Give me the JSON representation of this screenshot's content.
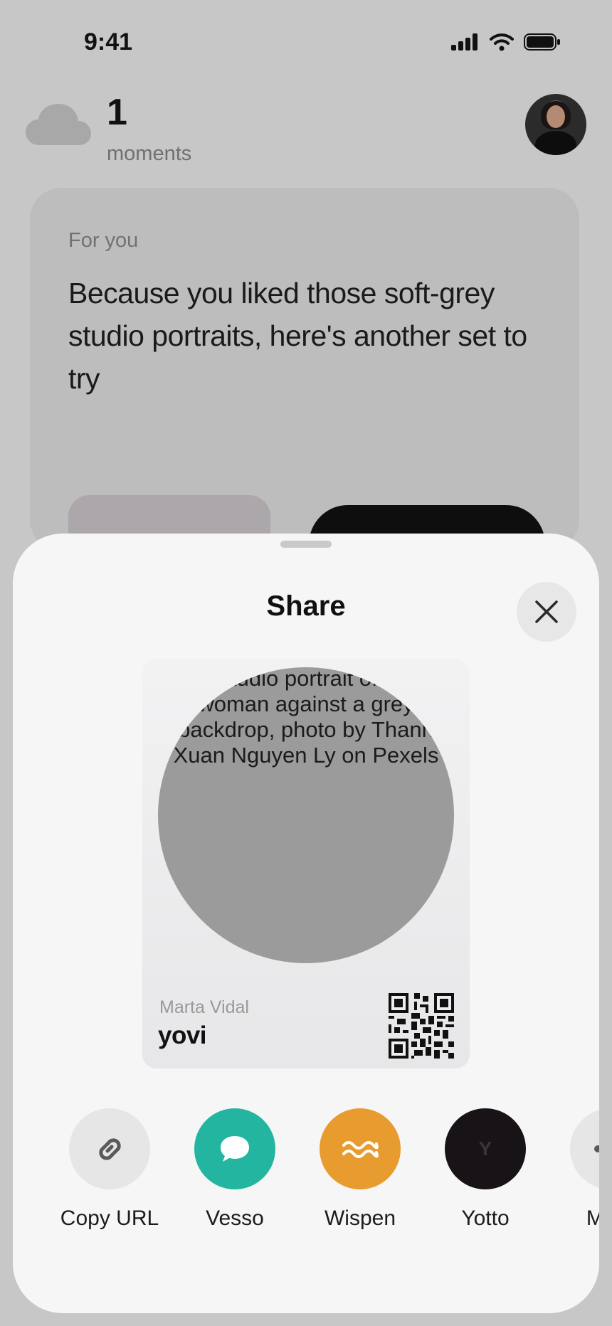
{
  "status_bar": {
    "time": "9:41"
  },
  "header": {
    "moments_count": "1",
    "moments_label": "moments"
  },
  "feed_card": {
    "kicker": "For you",
    "text": "Because you liked those soft-grey studio portraits, here's another set to try"
  },
  "share_sheet": {
    "title": "Share",
    "preview": {
      "alt_text": "Studio portrait of a\nwoman against a grey\nbackdrop, photo by Thanh\nXuan Nguyen Ly on Pexels",
      "author": "Marta Vidal",
      "brand": "yovi"
    },
    "targets": [
      {
        "label": "Copy URL",
        "icon": "link-icon",
        "color": "#e6e6e6"
      },
      {
        "label": "Vesso",
        "icon": "chat-bubble-icon",
        "color": "#24b5a0"
      },
      {
        "label": "Wispen",
        "icon": "wave-icon",
        "color": "#e89c30"
      },
      {
        "label": "Yotto",
        "icon": "yotto-logo-icon",
        "color": "#171317",
        "glyph": "Y"
      },
      {
        "label": "More",
        "icon": "more-icon",
        "color": "#e6e6e6"
      }
    ]
  },
  "colors": {
    "background": "#c7c7c7",
    "sheet": "#f6f6f6",
    "vesso": "#24b5a0",
    "wispen": "#e89c30",
    "yotto": "#171317"
  }
}
